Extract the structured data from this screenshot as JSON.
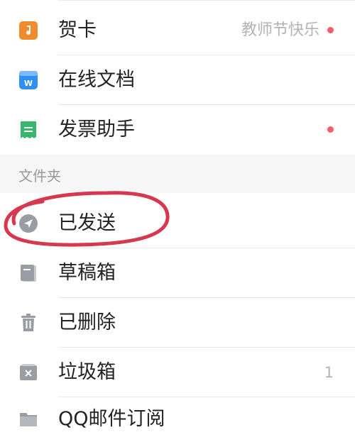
{
  "apps": [
    {
      "label": "贺卡",
      "extra": "教师节快乐",
      "dot": true,
      "icon": "music-note-icon",
      "color": "#f28a30"
    },
    {
      "label": "在线文档",
      "extra": "",
      "dot": false,
      "icon": "word-doc-icon",
      "color": "#2f8ff2"
    },
    {
      "label": "发票助手",
      "extra": "",
      "dot": true,
      "icon": "receipt-icon",
      "color": "#3ab56d"
    }
  ],
  "folders_section_title": "文件夹",
  "folders": [
    {
      "label": "已发送",
      "icon": "send-icon",
      "count": ""
    },
    {
      "label": "草稿箱",
      "icon": "draft-icon",
      "count": ""
    },
    {
      "label": "已删除",
      "icon": "trash-icon",
      "count": ""
    },
    {
      "label": "垃圾箱",
      "icon": "spam-icon",
      "count": "1"
    },
    {
      "label": "QQ邮件订阅",
      "icon": "folder-icon",
      "count": ""
    }
  ],
  "colors": {
    "accent_dot": "#f0606c",
    "icon_gray": "#9a9da3",
    "annotation_circle": "#d6394f"
  }
}
